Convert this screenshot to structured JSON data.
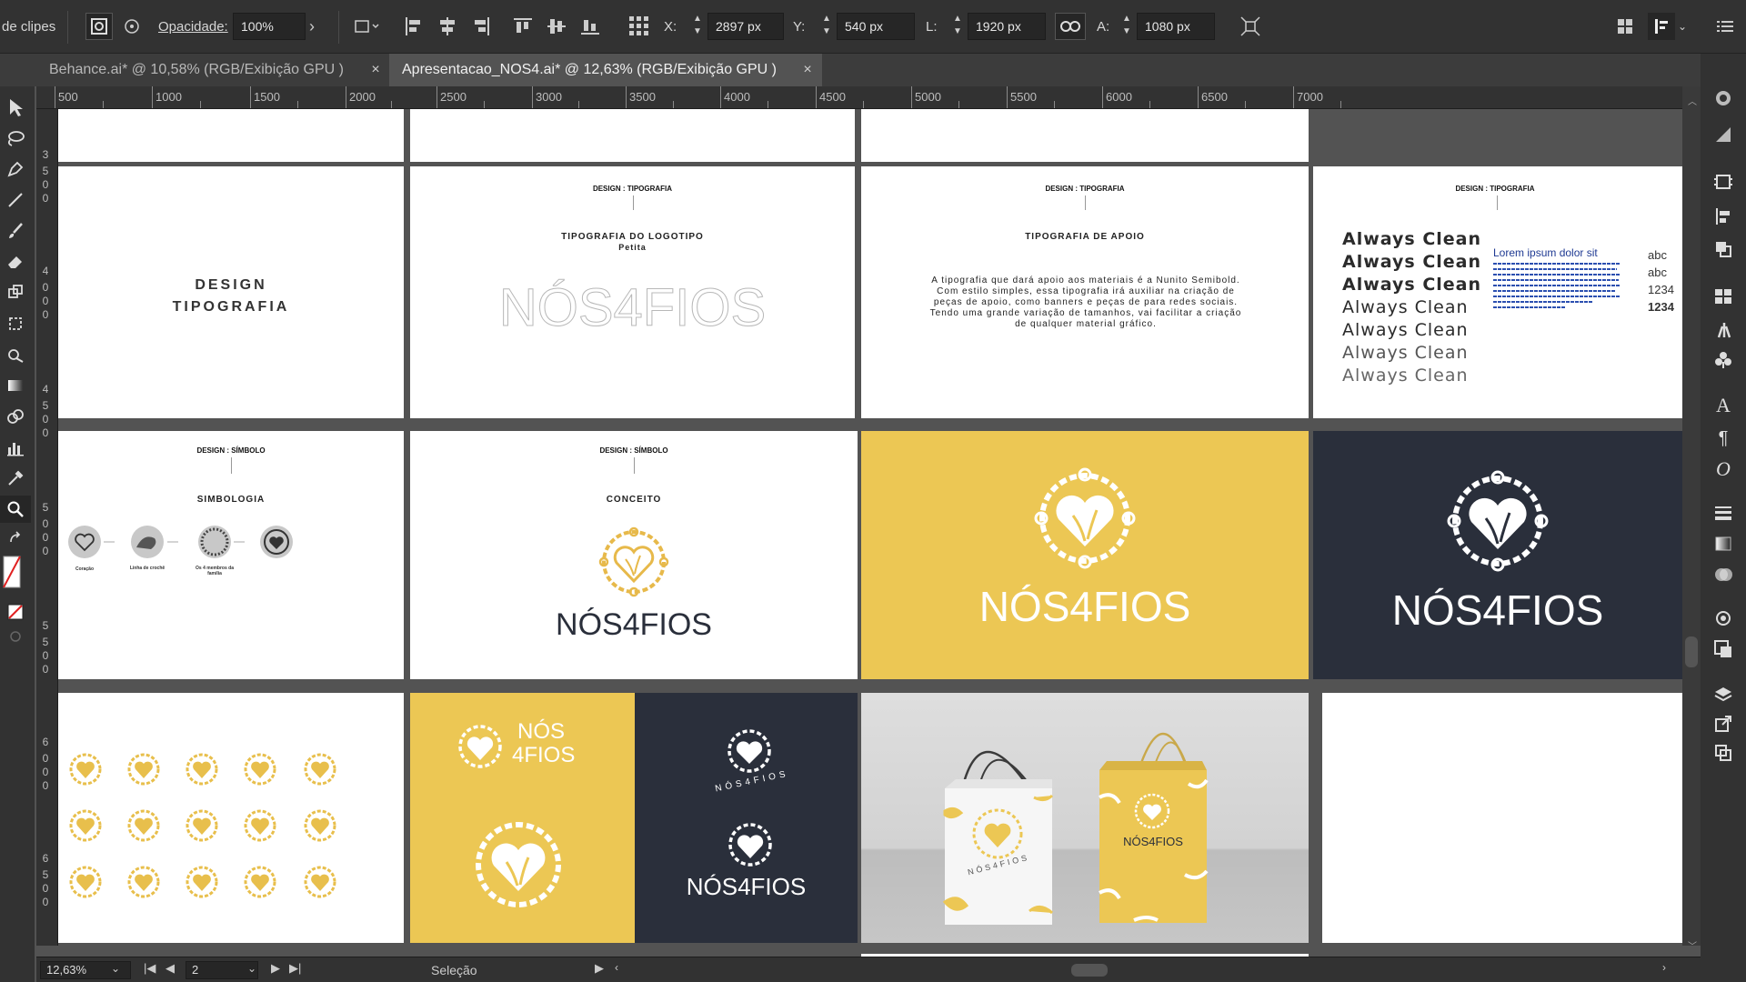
{
  "control": {
    "left_fragment": "de clipes",
    "opacity_label": "Opacidade:",
    "opacity_value": "100%",
    "x_label": "X:",
    "x_value": "2897 px",
    "y_label": "Y:",
    "y_value": "540 px",
    "w_label": "L:",
    "w_value": "1920 px",
    "h_label": "A:",
    "h_value": "1080 px"
  },
  "tabs": [
    {
      "label": "Behance.ai* @ 10,58% (RGB/Exibição GPU )",
      "active": false
    },
    {
      "label": "Apresentacao_NOS4.ai* @ 12,63% (RGB/Exibição GPU )",
      "active": true
    }
  ],
  "tab_close": "×",
  "ruler_h": [
    "500",
    "1000",
    "1500",
    "2000",
    "2500",
    "3000",
    "3500",
    "4000",
    "4500",
    "5000",
    "5500",
    "6000",
    "6500",
    "7000"
  ],
  "ruler_v": [
    "3",
    "5",
    "0",
    "0",
    "4",
    "0",
    "0",
    "0",
    "4",
    "5",
    "0",
    "0",
    "5",
    "0",
    "0",
    "0",
    "5",
    "5",
    "0",
    "0",
    "6",
    "0",
    "0",
    "0",
    "6",
    "5",
    "0",
    "0"
  ],
  "artboards": {
    "typo_cover": {
      "line1": "DESIGN",
      "line2": "TIPOGRAFIA"
    },
    "logo_typo": {
      "header": "DESIGN : TIPOGRAFIA",
      "title": "TIPOGRAFIA DO LOGOTIPO",
      "subtitle": "Petita",
      "wordmark": "NÓS4FIOS"
    },
    "support_typo": {
      "header": "DESIGN : TIPOGRAFIA",
      "title": "TIPOGRAFIA DE APOIO",
      "body": "A tipografia que dará apoio aos materiais é a Nunito Semibold. Com estilo simples, essa tipografia irá auxiliar na criação de peças de apoio, como banners e peças de para redes sociais. Tendo uma grande variação de tamanhos, vai facilitar a criação de qualquer material gráfico."
    },
    "samples": {
      "header": "DESIGN : TIPOGRAFIA",
      "lines": [
        "Always Clean",
        "Always Clean",
        "Always Clean",
        "Always Clean",
        "Always Clean",
        "Always Clean",
        "Always Clean"
      ],
      "lorem": "Lorem ipsum dolor sit",
      "abc1": "abc",
      "abc2": "abc",
      "num1": "1234",
      "num2": "1234"
    },
    "symbology": {
      "header": "DESIGN : SÍMBOLO",
      "title": "SIMBOLOGIA",
      "labels": [
        "Coração",
        "Linha de crochê",
        "Os 4 membros da família",
        ""
      ]
    },
    "concept": {
      "header": "DESIGN : SÍMBOLO",
      "title": "CONCEITO",
      "wordmark": "NÓS4FIOS"
    },
    "logo_yellow": {
      "wordmark": "NÓS4FIOS"
    },
    "logo_navy": {
      "wordmark": "NÓS4FIOS"
    },
    "variations": {
      "stack1": "NÓS",
      "stack2": "4FIOS",
      "circle_text": "NÓS4FIOS",
      "navy_wordmark": "NÓS4FIOS"
    },
    "mockup": {
      "bag_text": "NÓS4FIOS",
      "bag_circle": "NÓS4FIOS"
    }
  },
  "status": {
    "zoom": "12,63%",
    "artboard_num": "2",
    "tool_name": "Seleção"
  },
  "colors": {
    "yellow": "#ecc754",
    "navy": "#2a2f3b",
    "panel": "#323232",
    "canvas": "#535353"
  }
}
